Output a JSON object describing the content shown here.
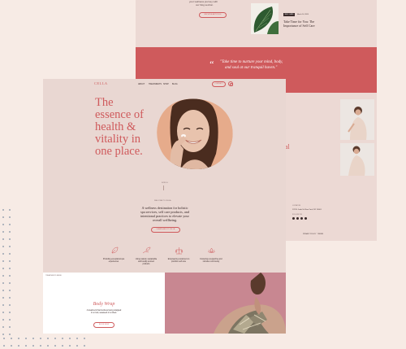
{
  "back_page": {
    "blog_intro_line": "your wellness journey with",
    "blog_intro_line2": "our blog section.",
    "blog_button": "BROWSE ARTICLES",
    "post_tag": "SELF CARE",
    "post_date": "March 14, 2024",
    "post_title_line1": "Take Time for You: The",
    "post_title_line2": "Importance of Self Care",
    "quote_mark": "“",
    "quote_line1": "\"Take time to nurture your mind, body,",
    "quote_line2": "and soul at our tranquil haven.\"",
    "contact_label": "LOCATION",
    "contact_address": "123 N. Jade St. New York, NY 10001",
    "social_label": "FOLLOW US",
    "social_icons": [
      "instagram-icon",
      "facebook-icon",
      "twitter-icon",
      "pinterest-icon"
    ],
    "footer_links": [
      "PRIVACY POLICY",
      "TERMS"
    ],
    "side_letter": "al",
    "colors": {
      "accent": "#cf5a5c",
      "card": "#ecd9d4"
    }
  },
  "front_page": {
    "logo": "CELLA",
    "nav": [
      "ABOUT",
      "TREATMENTS",
      "SHOP",
      "BLOG"
    ],
    "nav_button": "CONTACT",
    "hero_title": [
      "The",
      "essence of",
      "health &",
      "vitality in",
      "one place."
    ],
    "scroll_hint": "SCROLL",
    "welcome_label": "WELCOME TO CELLA",
    "intro_lines": [
      "A wellness destination for holistic",
      "spa services, self care products, and",
      "intentional practices to elevate your",
      "overall wellbeing."
    ],
    "intro_button": "LEARN ABOUT CELLA",
    "features": [
      {
        "icon": "leaf-icon",
        "lines": [
          "Providing exceptional spa",
          "experiences"
        ]
      },
      {
        "icon": "hand-leaf-icon",
        "lines": [
          "Using natural, sustainable",
          "and locally sourced",
          "products"
        ]
      },
      {
        "icon": "balance-icon",
        "lines": [
          "Empowering customers to",
          "prioritize self care"
        ]
      },
      {
        "icon": "lotus-icon",
        "lines": [
          "Fostering a supportive and",
          "inclusive community"
        ]
      }
    ],
    "section_label": "TREATMENTS MENU",
    "service_title": "Body Wrap",
    "service_lines": [
      "A treatment that involves being wrapped",
      "in a mud, seaweed or a sheet."
    ],
    "service_button": "BOOK NOW"
  }
}
